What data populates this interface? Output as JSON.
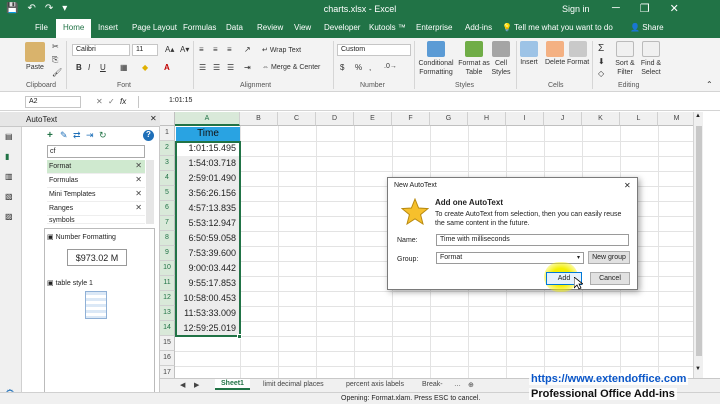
{
  "titlebar": {
    "title": "charts.xlsx - Excel",
    "signin": "Sign in",
    "qat_icons": [
      "save-icon",
      "undo-icon",
      "redo-icon"
    ],
    "win_min": "─",
    "win_restore": "❐",
    "win_close": "✕"
  },
  "tabs": [
    "File",
    "Home",
    "Insert",
    "Page Layout",
    "Formulas",
    "Data",
    "Review",
    "View",
    "Developer",
    "Kutools ™",
    "Enterprise",
    "Add-ins"
  ],
  "tell_me": "Tell me what you want to do",
  "share": "Share",
  "ribbon": {
    "paste": "Paste",
    "clipboard": "Clipboard",
    "font_name": "Calibri",
    "font_size": "11",
    "font_group": "Font",
    "bold": "B",
    "italic": "I",
    "underline": "U",
    "wrap_text": "Wrap Text",
    "merge_center": "Merge & Center",
    "alignment": "Alignment",
    "number_format": "Custom",
    "number": "Number",
    "conditional": "Conditional Formatting",
    "format_table": "Format as Table",
    "cell_styles": "Cell Styles",
    "styles": "Styles",
    "insert": "Insert",
    "delete": "Delete",
    "format": "Format",
    "cells": "Cells",
    "sort_filter": "Sort & Filter",
    "find_select": "Find & Select",
    "editing": "Editing",
    "sigma": "Σ",
    "currency": "$",
    "percent": "%",
    "comma": ","
  },
  "formula_bar": {
    "name_box": "A2",
    "fx": "fx",
    "value": "1:01:15"
  },
  "pane": {
    "title": "AutoText",
    "search_value": "cf",
    "categories": [
      {
        "label": "Format",
        "selected": true
      },
      {
        "label": "Formulas",
        "selected": false
      },
      {
        "label": "Mini Templates",
        "selected": false
      },
      {
        "label": "Ranges",
        "selected": false
      },
      {
        "label": "symbols",
        "selected": false
      }
    ],
    "entry1_name": "Number Formatting",
    "entry1_preview": "$973.02 M",
    "entry2_name": "table style 1"
  },
  "grid": {
    "columns": [
      "A",
      "B",
      "C",
      "D",
      "E",
      "F",
      "G",
      "H",
      "I",
      "J",
      "K",
      "L",
      "M"
    ],
    "rows": [
      "1",
      "2",
      "3",
      "4",
      "5",
      "6",
      "7",
      "8",
      "9",
      "10",
      "11",
      "12",
      "13",
      "14",
      "15",
      "16",
      "17"
    ],
    "header": "Time",
    "values": [
      "1:01:15.495",
      "1:54:03.718",
      "2:59:01.490",
      "3:56:26.156",
      "4:57:13.835",
      "5:53:12.947",
      "6:50:59.058",
      "7:53:39.600",
      "9:00:03.442",
      "9:55:17.853",
      "10:58:00.453",
      "11:53:33.009",
      "12:59:25.019"
    ]
  },
  "sheets": {
    "items": [
      "Sheet1",
      "limit decimal places",
      "percent axis labels",
      "Break-"
    ],
    "active": "Sheet1"
  },
  "status": {
    "message": "Opening: Format.xlam. Press ESC to cancel."
  },
  "dialog": {
    "title": "New AutoText",
    "heading": "Add one AutoText",
    "description": "To create AutoText from selection, then you can easily reuse the same content in the future.",
    "name_label": "Name:",
    "name_value": "Time with milliseconds",
    "group_label": "Group:",
    "group_value": "Format",
    "new_group": "New group",
    "add": "Add",
    "cancel": "Cancel",
    "close": "✕"
  },
  "watermark": {
    "url": "https://www.extendoffice.com",
    "brand": "Professional Office Add-ins"
  },
  "colors": {
    "excel_green": "#217346",
    "selected_header": "#29a3e2",
    "selected_row": "#d4ecd4",
    "highlight": "#f4f000"
  }
}
